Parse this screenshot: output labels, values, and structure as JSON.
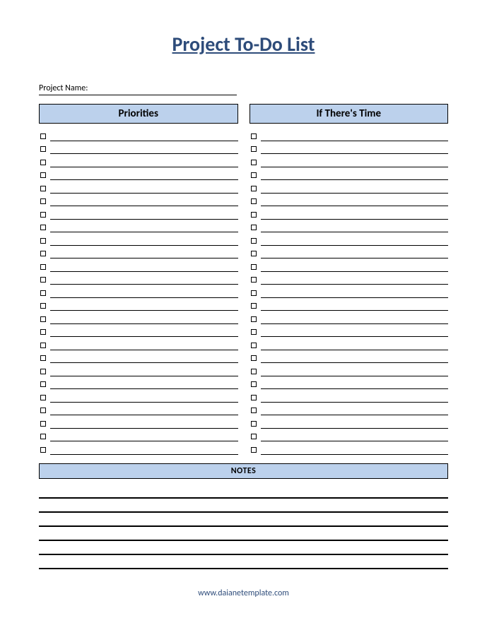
{
  "title": "Project To-Do List",
  "project_name_label": "Project Name:",
  "project_name_value": "",
  "columns": {
    "priorities": {
      "header": "Priorities",
      "items": [
        "",
        "",
        "",
        "",
        "",
        "",
        "",
        "",
        "",
        "",
        "",
        "",
        "",
        "",
        "",
        "",
        "",
        "",
        "",
        "",
        "",
        "",
        "",
        "",
        ""
      ]
    },
    "if_time": {
      "header": "If There's Time",
      "items": [
        "",
        "",
        "",
        "",
        "",
        "",
        "",
        "",
        "",
        "",
        "",
        "",
        "",
        "",
        "",
        "",
        "",
        "",
        "",
        "",
        "",
        "",
        "",
        "",
        ""
      ]
    }
  },
  "notes_header": "NOTES",
  "notes_lines": [
    "",
    "",
    "",
    "",
    "",
    ""
  ],
  "footer_url": "www.daianetemplate.com",
  "colors": {
    "accent_blue": "#bcd1ec",
    "title_blue": "#2e4c7a"
  }
}
